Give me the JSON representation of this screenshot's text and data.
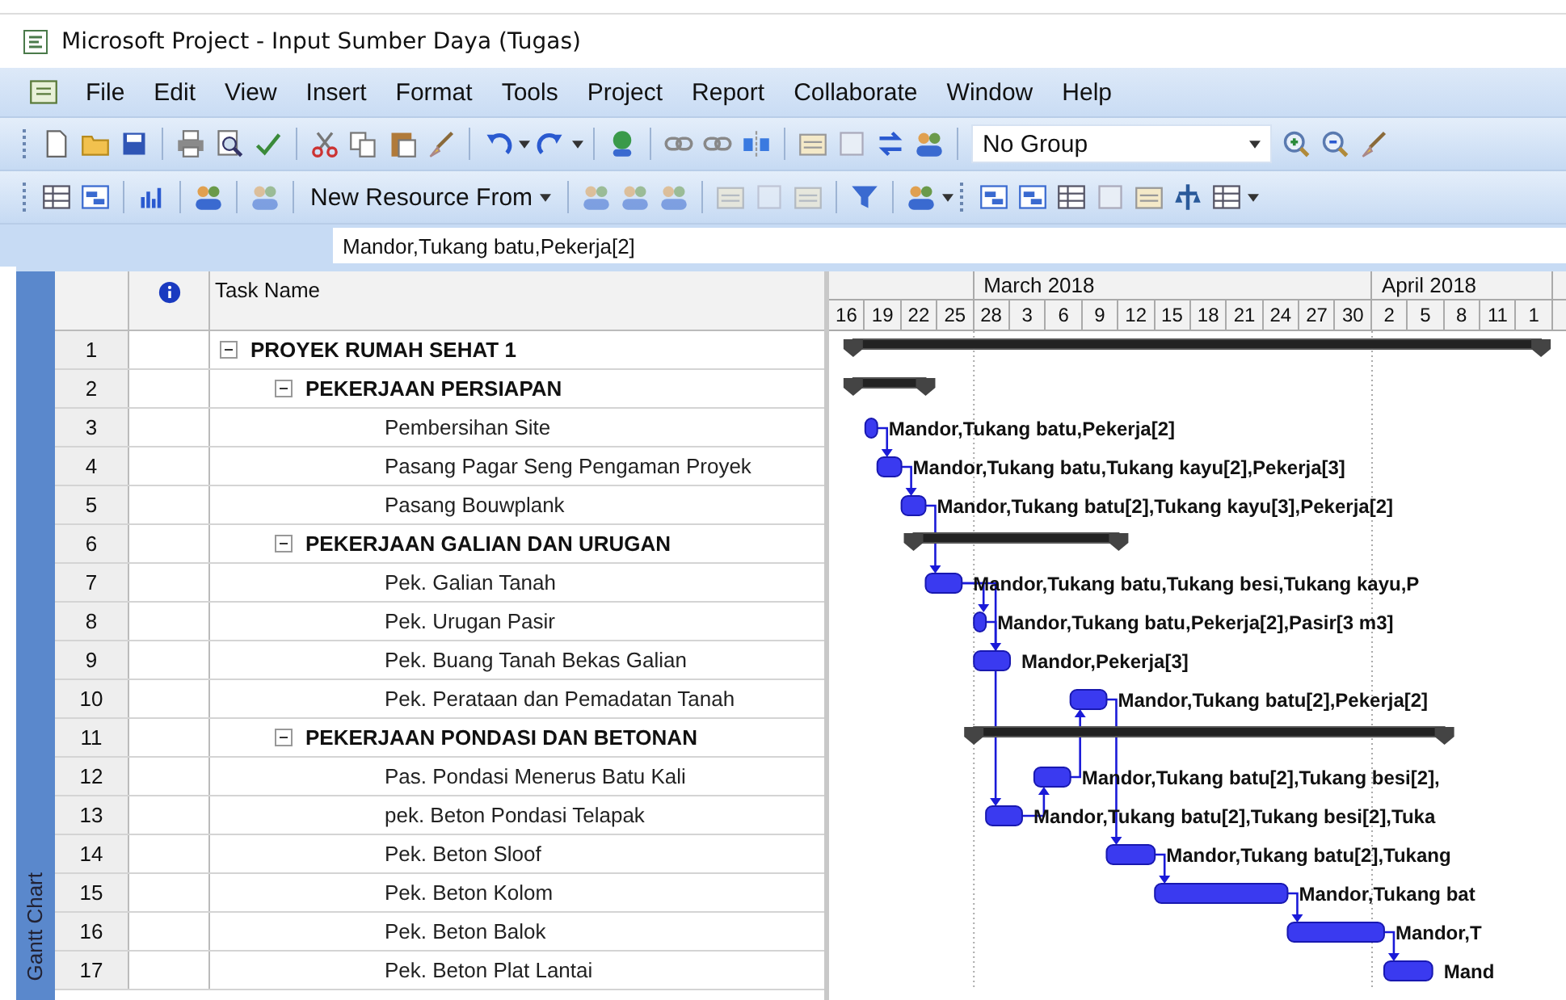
{
  "window": {
    "title": "Microsoft Project - Input Sumber Daya (Tugas)"
  },
  "menu": [
    "File",
    "Edit",
    "View",
    "Insert",
    "Format",
    "Tools",
    "Project",
    "Report",
    "Collaborate",
    "Window",
    "Help"
  ],
  "toolbar": {
    "group_dropdown": "No Group",
    "new_resource_button": "New Resource From"
  },
  "entry_bar": {
    "value": "Mandor,Tukang batu,Pekerja[2]"
  },
  "view_bar": {
    "label": "Gantt Chart"
  },
  "table": {
    "columns": [
      "Task Name"
    ]
  },
  "timescale": {
    "months": [
      {
        "days": [
          "16",
          "19",
          "22",
          "25"
        ]
      },
      {
        "label": "March 2018",
        "days": [
          "28",
          "3",
          "6",
          "9",
          "12",
          "15",
          "18",
          "21",
          "24",
          "27",
          "30"
        ]
      },
      {
        "label": "April 2018",
        "days": [
          "2",
          "5",
          "8",
          "11",
          "1"
        ]
      }
    ]
  },
  "tasks": [
    {
      "number": "1",
      "name": "PROYEK RUMAH SEHAT 1",
      "kind": "summary",
      "expanded": true,
      "children": [
        {
          "number": "2",
          "name": "PEKERJAAN PERSIAPAN",
          "kind": "summary",
          "expanded": true,
          "children": [
            {
              "number": "3",
              "name": "Pembersihan Site",
              "kind": "task",
              "resources": "Mandor,Tukang batu,Pekerja[2]"
            },
            {
              "number": "4",
              "name": "Pasang Pagar Seng Pengaman Proyek",
              "kind": "task",
              "resources": "Mandor,Tukang batu,Tukang kayu[2],Pekerja[3]"
            },
            {
              "number": "5",
              "name": "Pasang Bouwplank",
              "kind": "task",
              "resources": "Mandor,Tukang batu[2],Tukang kayu[3],Pekerja[2]"
            }
          ]
        },
        {
          "number": "6",
          "name": "PEKERJAAN GALIAN DAN URUGAN",
          "kind": "summary",
          "expanded": true,
          "children": [
            {
              "number": "7",
              "name": "Pek. Galian Tanah",
              "kind": "task",
              "resources": "Mandor,Tukang batu,Tukang besi,Tukang kayu,P"
            },
            {
              "number": "8",
              "name": "Pek. Urugan Pasir",
              "kind": "task",
              "resources": "Mandor,Tukang batu,Pekerja[2],Pasir[3 m3]"
            },
            {
              "number": "9",
              "name": "Pek. Buang Tanah Bekas Galian",
              "kind": "task",
              "resources": "Mandor,Pekerja[3]"
            },
            {
              "number": "10",
              "name": "Pek. Perataan dan Pemadatan Tanah",
              "kind": "task",
              "resources": "Mandor,Tukang batu[2],Pekerja[2]"
            }
          ]
        },
        {
          "number": "11",
          "name": "PEKERJAAN PONDASI DAN BETONAN",
          "kind": "summary",
          "expanded": true,
          "children": [
            {
              "number": "12",
              "name": "Pas. Pondasi Menerus Batu Kali",
              "kind": "task",
              "resources": "Mandor,Tukang batu[2],Tukang besi[2],"
            },
            {
              "number": "13",
              "name": "pek. Beton Pondasi Telapak",
              "kind": "task",
              "resources": "Mandor,Tukang batu[2],Tukang besi[2],Tuka"
            },
            {
              "number": "14",
              "name": "Pek. Beton Sloof",
              "kind": "task",
              "resources": "Mandor,Tukang batu[2],Tukang"
            },
            {
              "number": "15",
              "name": "Pek. Beton Kolom",
              "kind": "task",
              "resources": "Mandor,Tukang bat"
            },
            {
              "number": "16",
              "name": "Pek. Beton Balok",
              "kind": "task",
              "resources": "Mandor,T"
            },
            {
              "number": "17",
              "name": "Pek. Beton Plat Lantai",
              "kind": "task",
              "resources": "Mand"
            }
          ]
        }
      ]
    }
  ]
}
